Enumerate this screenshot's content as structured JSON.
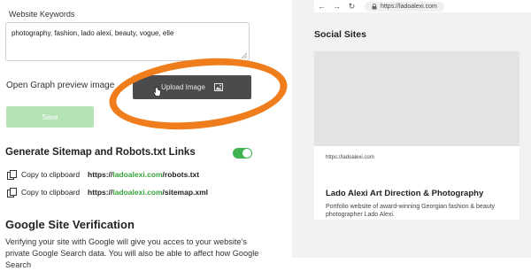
{
  "keywords": {
    "label": "Website Keywords",
    "value": "photography, fashion, lado alexi, beauty, vogue, elle"
  },
  "open_graph": {
    "label": "Open Graph preview image",
    "upload_label": "Upload Image"
  },
  "save_label": "Save",
  "sitemap": {
    "title": "Generate Sitemap and Robots.txt Links",
    "toggle_on": true,
    "rows": [
      {
        "copy_label": "Copy to clipboard",
        "url_prefix": "https://",
        "url_domain": "ladoalexi.com",
        "url_path": "/robots.txt"
      },
      {
        "copy_label": "Copy to clipboard",
        "url_prefix": "https://",
        "url_domain": "ladoalexi.com",
        "url_path": "/sitemap.xml"
      }
    ]
  },
  "google": {
    "title": "Google Site Verification",
    "text": "Verifying your site with Google will give you acces to your website's private Google Search data. You will also be able to affect how Google Search"
  },
  "browser": {
    "back_glyph": "←",
    "forward_glyph": "→",
    "reload_glyph": "↻",
    "address": "https://ladoalexi.com"
  },
  "social": {
    "title": "Social Sites",
    "card_url": "https://ladoalexi.com",
    "card_title": "Lado Alexi Art Direction & Photography",
    "card_desc": "Portfolio website of award-winning Georgian fashion & beauty photographer Lado Alexi."
  },
  "colors": {
    "accent_green": "#37a33a",
    "toggle_green": "#3fb34f",
    "highlight_orange": "#f07d1b",
    "upload_button_bg": "#4b4b4b"
  }
}
